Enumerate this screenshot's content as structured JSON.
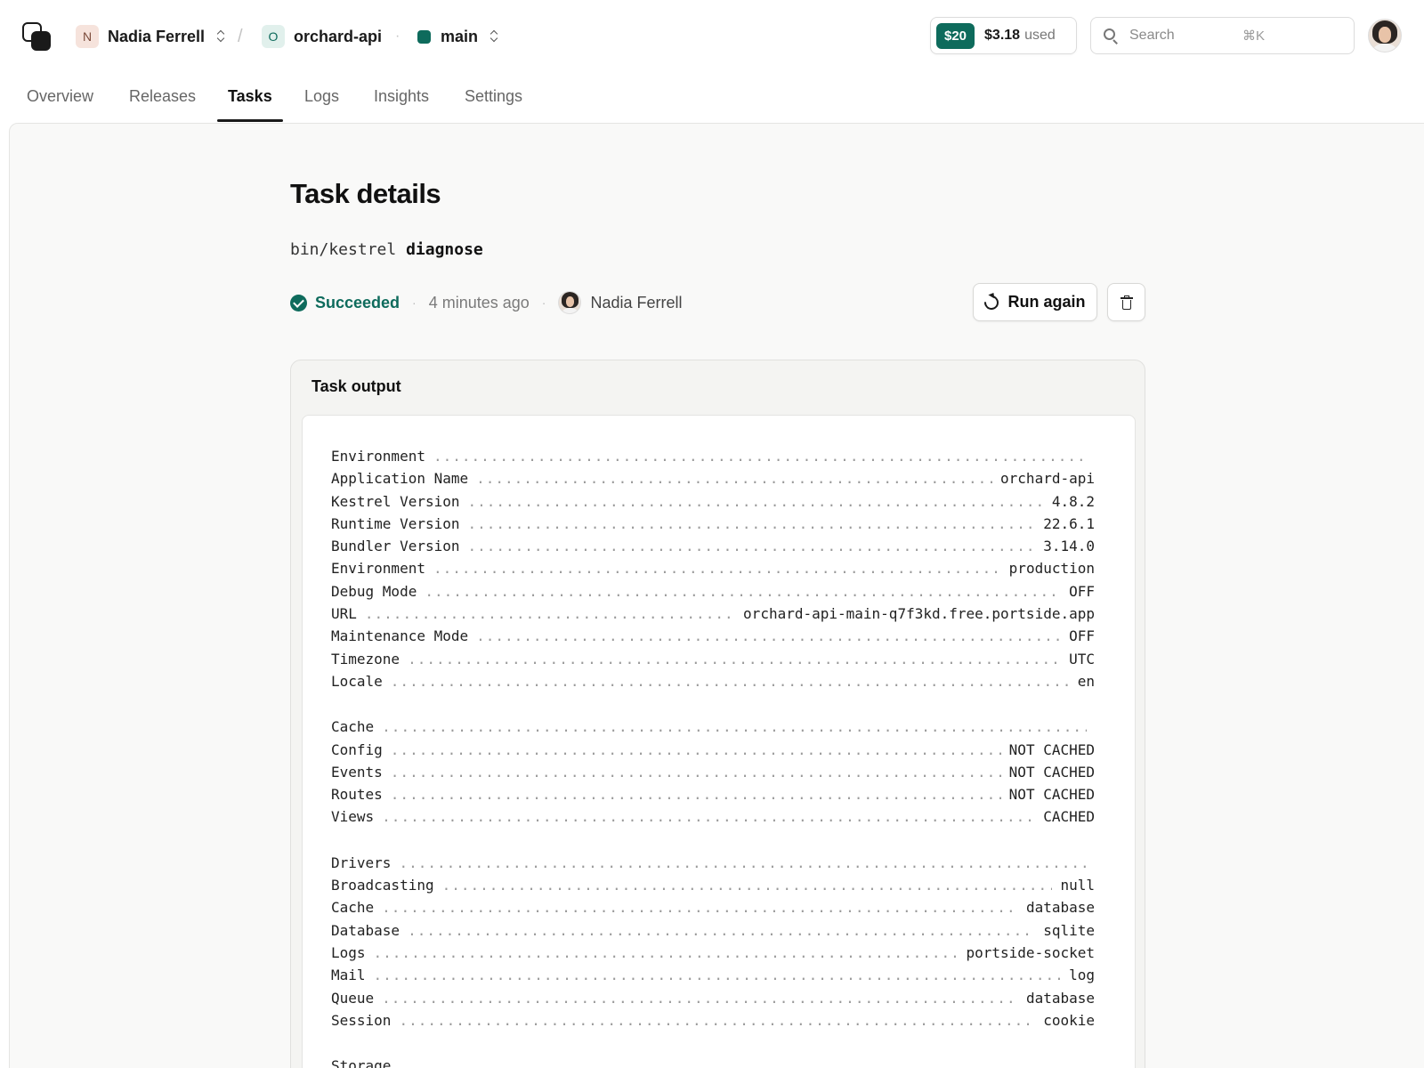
{
  "topbar": {
    "org": {
      "initial": "N",
      "name": "Nadia Ferrell"
    },
    "project": {
      "initial": "O",
      "name": "orchard-api"
    },
    "branch": {
      "name": "main",
      "color": "#0e6b5c"
    },
    "usage": {
      "limit": "$20",
      "amount": "$3.18",
      "suffix": "used"
    },
    "search": {
      "placeholder": "Search",
      "shortcut": "⌘K"
    }
  },
  "tabs": [
    {
      "label": "Overview"
    },
    {
      "label": "Releases"
    },
    {
      "label": "Tasks",
      "active": true
    },
    {
      "label": "Logs"
    },
    {
      "label": "Insights"
    },
    {
      "label": "Settings"
    }
  ],
  "task": {
    "title": "Task details",
    "command_bin": "bin/kestrel",
    "command_arg": "diagnose",
    "status": "Succeeded",
    "time": "4 minutes ago",
    "user": "Nadia Ferrell",
    "run_again_label": "Run again"
  },
  "output": {
    "title": "Task output",
    "sections": [
      {
        "heading": "Environment",
        "rows": [
          {
            "key": "Application Name",
            "value": "orchard-api"
          },
          {
            "key": "Kestrel Version",
            "value": "4.8.2"
          },
          {
            "key": "Runtime Version",
            "value": "22.6.1"
          },
          {
            "key": "Bundler Version",
            "value": "3.14.0"
          },
          {
            "key": "Environment",
            "value": "production"
          },
          {
            "key": "Debug Mode",
            "value": "OFF"
          },
          {
            "key": "URL",
            "value": "orchard-api-main-q7f3kd.free.portside.app"
          },
          {
            "key": "Maintenance Mode",
            "value": "OFF"
          },
          {
            "key": "Timezone",
            "value": "UTC"
          },
          {
            "key": "Locale",
            "value": "en"
          }
        ]
      },
      {
        "heading": "Cache",
        "rows": [
          {
            "key": "Config",
            "value": "NOT CACHED"
          },
          {
            "key": "Events",
            "value": "NOT CACHED"
          },
          {
            "key": "Routes",
            "value": "NOT CACHED"
          },
          {
            "key": "Views",
            "value": "CACHED"
          }
        ]
      },
      {
        "heading": "Drivers",
        "rows": [
          {
            "key": "Broadcasting",
            "value": "null"
          },
          {
            "key": "Cache",
            "value": "database"
          },
          {
            "key": "Database",
            "value": "sqlite"
          },
          {
            "key": "Logs",
            "value": "portside-socket"
          },
          {
            "key": "Mail",
            "value": "log"
          },
          {
            "key": "Queue",
            "value": "database"
          },
          {
            "key": "Session",
            "value": "cookie"
          }
        ]
      },
      {
        "heading": "Storage",
        "rows": []
      }
    ]
  },
  "colors": {
    "accent": "#0e6b5c"
  }
}
